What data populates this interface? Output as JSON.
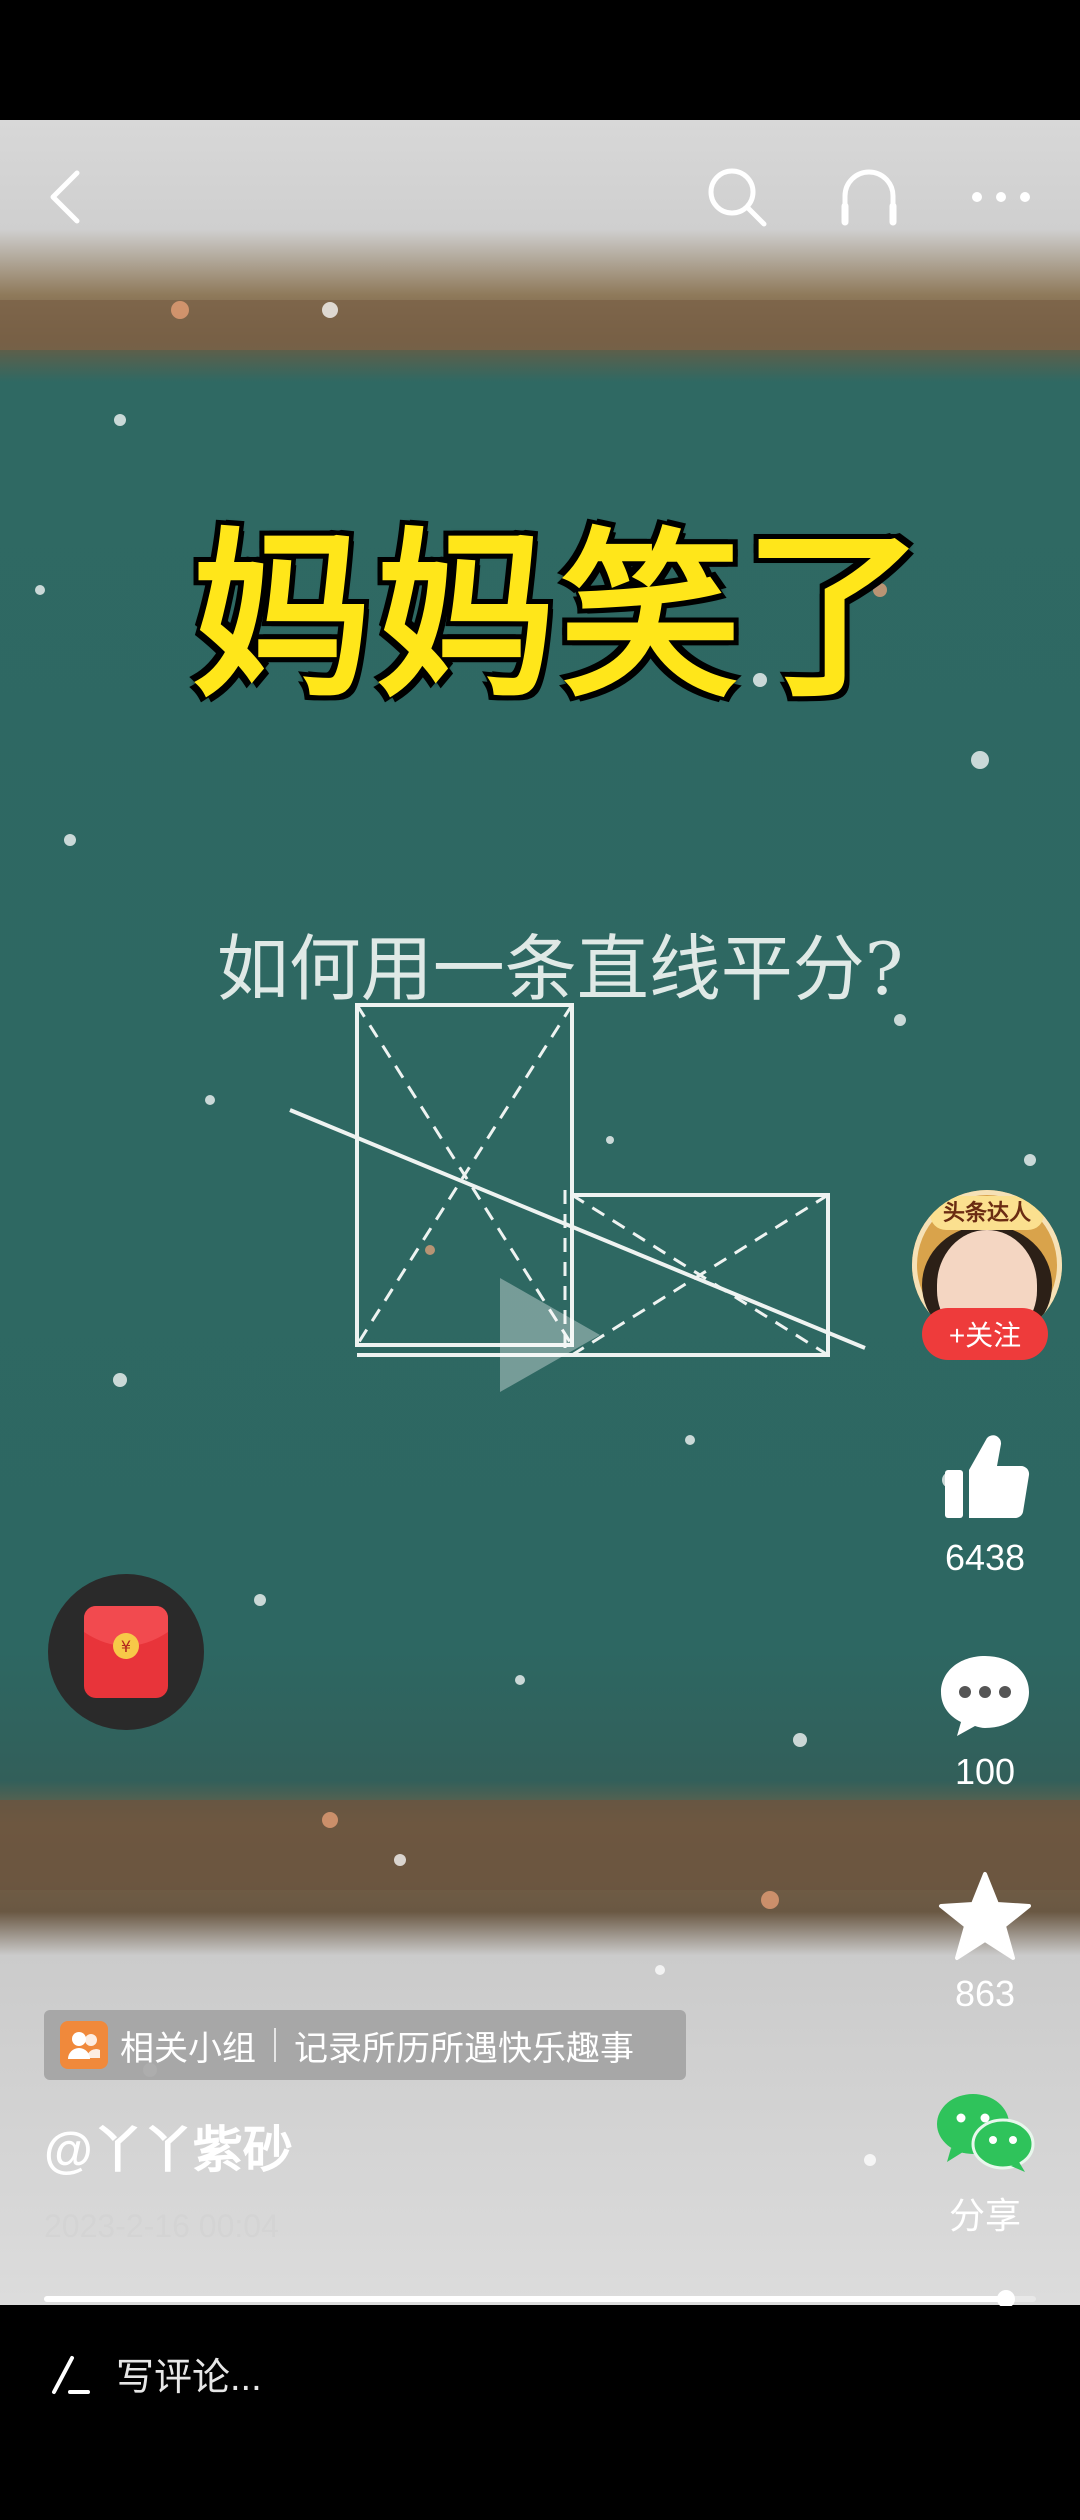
{
  "overlay": {
    "title": "妈妈笑了",
    "question": "如何用一条直线平分?"
  },
  "nav": {
    "back_icon": "back-icon",
    "search_icon": "search-icon",
    "listen_icon": "headphones-icon",
    "more_icon": "more-icon"
  },
  "creator": {
    "avatar_badge": "头条达人",
    "follow_label": "+关注"
  },
  "actions": {
    "likes": "6438",
    "comments": "100",
    "favorites": "863",
    "share_label": "分享"
  },
  "group": {
    "label": "相关小组",
    "name": "记录所历所遇快乐趣事"
  },
  "post": {
    "username": "@丫丫紫砂",
    "date": "2023-2-16 00:04"
  },
  "progress": {
    "fraction": 0.97
  },
  "comment": {
    "placeholder": "写评论..."
  },
  "colors": {
    "title_yellow": "#ffe61a",
    "follow_red": "#ee3b3b",
    "share_green": "#2fc35b",
    "group_orange": "#f0893b",
    "chalkboard": "#2d6762"
  }
}
